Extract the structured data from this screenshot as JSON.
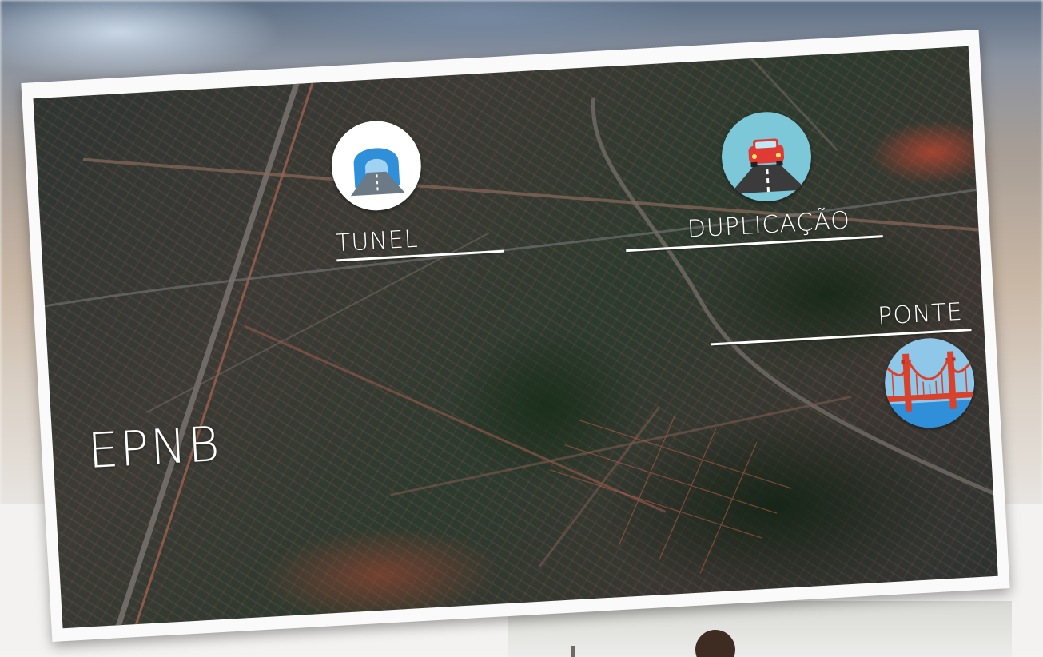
{
  "map": {
    "title": "EPNB",
    "markers": [
      {
        "id": "tunel",
        "label": "TUNEL",
        "icon": "tunnel-icon",
        "color": "#2f8fd8"
      },
      {
        "id": "duplicacao",
        "label": "DUPLICAÇÃO",
        "icon": "car-road-icon",
        "color": "#7cc7d8"
      },
      {
        "id": "ponte",
        "label": "PONTE",
        "icon": "bridge-icon",
        "color": "#d8412c"
      }
    ]
  }
}
